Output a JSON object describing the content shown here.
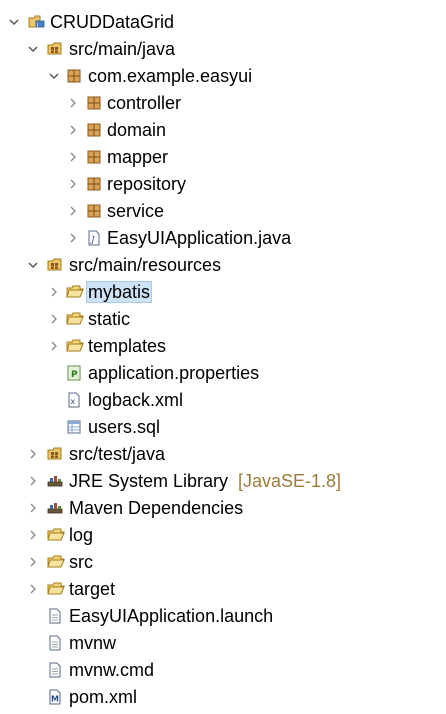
{
  "project": {
    "name": "CRUDDataGrid",
    "expanded": true
  },
  "items": [
    {
      "label": "src/main/java",
      "icon": "source-folder-icon",
      "level": 1,
      "arrow": "expanded"
    },
    {
      "label": "com.example.easyui",
      "icon": "package-icon",
      "level": 2,
      "arrow": "expanded"
    },
    {
      "label": "controller",
      "icon": "package-icon",
      "level": 3,
      "arrow": "collapsed"
    },
    {
      "label": "domain",
      "icon": "package-icon",
      "level": 3,
      "arrow": "collapsed"
    },
    {
      "label": "mapper",
      "icon": "package-icon",
      "level": 3,
      "arrow": "collapsed"
    },
    {
      "label": "repository",
      "icon": "package-icon",
      "level": 3,
      "arrow": "collapsed"
    },
    {
      "label": "service",
      "icon": "package-icon",
      "level": 3,
      "arrow": "collapsed"
    },
    {
      "label": "EasyUIApplication.java",
      "icon": "java-file-icon",
      "level": 3,
      "arrow": "collapsed"
    },
    {
      "label": "src/main/resources",
      "icon": "source-folder-icon",
      "level": 1,
      "arrow": "expanded"
    },
    {
      "label": "mybatis",
      "icon": "folder-icon",
      "level": 2,
      "arrow": "collapsed",
      "selected": true
    },
    {
      "label": "static",
      "icon": "folder-icon",
      "level": 2,
      "arrow": "collapsed"
    },
    {
      "label": "templates",
      "icon": "folder-icon",
      "level": 2,
      "arrow": "collapsed"
    },
    {
      "label": "application.properties",
      "icon": "properties-file-icon",
      "level": 2,
      "arrow": "none"
    },
    {
      "label": "logback.xml",
      "icon": "xml-file-icon",
      "level": 2,
      "arrow": "none"
    },
    {
      "label": "users.sql",
      "icon": "sql-file-icon",
      "level": 2,
      "arrow": "none"
    },
    {
      "label": "src/test/java",
      "icon": "source-folder-icon",
      "level": 1,
      "arrow": "collapsed"
    },
    {
      "label": "JRE System Library",
      "decoration": "[JavaSE-1.8]",
      "icon": "library-icon",
      "level": 1,
      "arrow": "collapsed"
    },
    {
      "label": "Maven Dependencies",
      "icon": "library-icon",
      "level": 1,
      "arrow": "collapsed"
    },
    {
      "label": "log",
      "icon": "folder-icon",
      "level": 1,
      "arrow": "collapsed"
    },
    {
      "label": "src",
      "icon": "folder-icon",
      "level": 1,
      "arrow": "collapsed"
    },
    {
      "label": "target",
      "icon": "folder-icon",
      "level": 1,
      "arrow": "collapsed"
    },
    {
      "label": "EasyUIApplication.launch",
      "icon": "file-icon",
      "level": 1,
      "arrow": "none"
    },
    {
      "label": "mvnw",
      "icon": "file-icon",
      "level": 1,
      "arrow": "none"
    },
    {
      "label": "mvnw.cmd",
      "icon": "file-icon",
      "level": 1,
      "arrow": "none"
    },
    {
      "label": "pom.xml",
      "icon": "maven-pom-icon",
      "level": 1,
      "arrow": "none"
    }
  ],
  "colors": {
    "selection": "#cfe3f7",
    "decoration": "#9b7a3a",
    "folder": "#e8c56a",
    "package": "#b5651d"
  }
}
